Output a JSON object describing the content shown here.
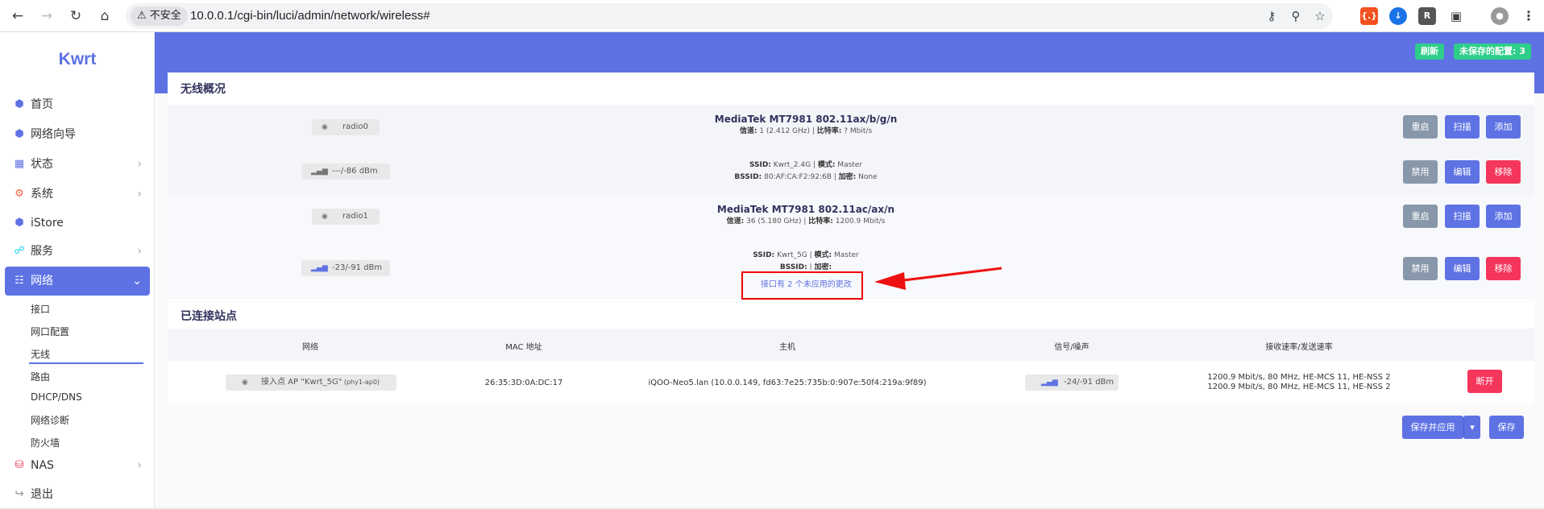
{
  "browser": {
    "url": "10.0.0.1/cgi-bin/luci/admin/network/wireless#",
    "security_label": "不安全"
  },
  "sidebar": {
    "logo": "Kwrt",
    "items": [
      {
        "label": "首页"
      },
      {
        "label": "网络向导"
      },
      {
        "label": "状态"
      },
      {
        "label": "系统"
      },
      {
        "label": "iStore"
      },
      {
        "label": "服务"
      },
      {
        "label": "网络"
      },
      {
        "label": "NAS"
      },
      {
        "label": "退出"
      }
    ],
    "network_sub": [
      "接口",
      "网口配置",
      "无线",
      "路由",
      "DHCP/DNS",
      "网络诊断",
      "防火墙"
    ]
  },
  "header": {
    "refresh_label": "刷新",
    "unsaved_label": "未保存的配置: 3"
  },
  "wireless": {
    "title": "无线概况",
    "radios": [
      {
        "name": "radio0",
        "device": "MediaTek MT7981 802.11ax/b/g/n",
        "channel_label": "信道:",
        "channel_value": " 1 (2.412 GHz) | ",
        "rate_label": "比特率:",
        "rate_value": " ? Mbit/s",
        "buttons": [
          "重启",
          "扫描",
          "添加"
        ],
        "iface": {
          "signal": "---/-86 dBm",
          "ssid_label": "SSID:",
          "ssid_value": " Kwrt_2.4G | ",
          "mode_label": "模式:",
          "mode_value": " Master",
          "bssid_label": "BSSID:",
          "bssid_value": " 80:AF:CA:F2:92:6B | ",
          "enc_label": "加密:",
          "enc_value": " None",
          "buttons": [
            "禁用",
            "编辑",
            "移除"
          ]
        }
      },
      {
        "name": "radio1",
        "device": "MediaTek MT7981 802.11ac/ax/n",
        "channel_label": "信道:",
        "channel_value": " 36 (5.180 GHz) | ",
        "rate_label": "比特率:",
        "rate_value": " 1200.9 Mbit/s",
        "buttons": [
          "重启",
          "扫描",
          "添加"
        ],
        "iface": {
          "signal": "-23/-91 dBm",
          "ssid_label": "SSID:",
          "ssid_value": " Kwrt_5G | ",
          "mode_label": "模式:",
          "mode_value": " Master",
          "bssid_label": "BSSID:",
          "bssid_value": " | ",
          "enc_label": "加密:",
          "enc_value": "",
          "pending": "接口有 2 个未应用的更改",
          "buttons": [
            "禁用",
            "编辑",
            "移除"
          ]
        }
      }
    ]
  },
  "stations": {
    "title": "已连接站点",
    "headers": [
      "网络",
      "MAC 地址",
      "主机",
      "信号/噪声",
      "接收速率/发送速率"
    ],
    "row": {
      "network": "接入点 AP \"Kwrt_5G\"",
      "network_suffix": " (phy1-ap0)",
      "mac": "26:35:3D:0A:DC:17",
      "host": "iQOO-Neo5.lan (10.0.0.149, fd63:7e25:735b:0:907e:50f4:219a:9f89)",
      "signal": "-24/-91 dBm",
      "rate_rx": "1200.9 Mbit/s, 80 MHz, HE-MCS 11, HE-NSS 2",
      "rate_tx": "1200.9 Mbit/s, 80 MHz, HE-MCS 11, HE-NSS 2",
      "disconnect": "断开"
    }
  },
  "footer": {
    "save_apply": "保存并应用",
    "save": "保存"
  },
  "colors": {
    "accent": "#5e72e4",
    "success": "#2dce89",
    "danger": "#f5365c",
    "muted": "#8898aa"
  }
}
